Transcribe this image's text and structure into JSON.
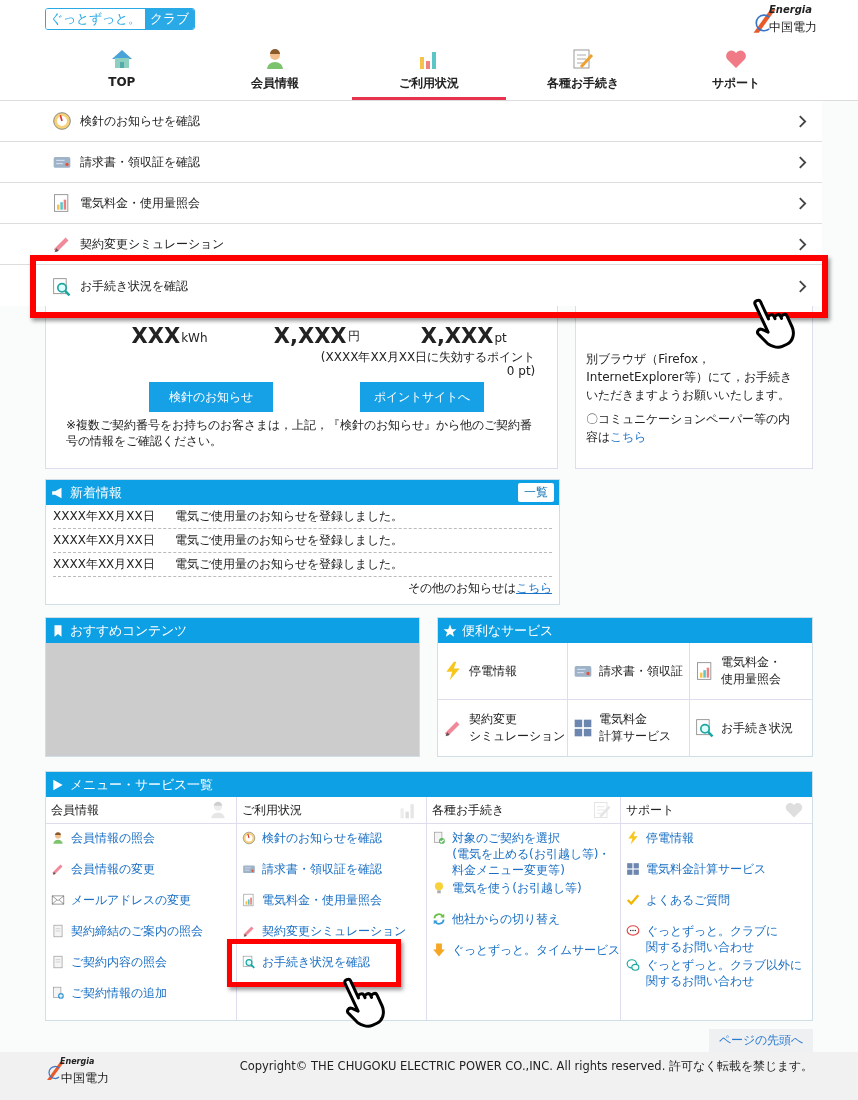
{
  "header": {
    "club_logo": {
      "text_1": "ぐっとずっと。",
      "text_2": "クラブ"
    },
    "brand": {
      "name": "Energia",
      "sub": "中国電力"
    }
  },
  "nav": [
    {
      "label": "TOP",
      "kind": "house",
      "selected": false
    },
    {
      "label": "会員情報",
      "kind": "person",
      "selected": false
    },
    {
      "label": "ご利用状況",
      "kind": "bars",
      "selected": true
    },
    {
      "label": "各種お手続き",
      "kind": "notepad",
      "selected": false
    },
    {
      "label": "サポート",
      "kind": "heart",
      "selected": false
    }
  ],
  "dropdown": [
    {
      "label": "検針のお知らせを確認",
      "kind": "gauge",
      "highlighted": false
    },
    {
      "label": "請求書・領収証を確認",
      "kind": "card",
      "highlighted": false
    },
    {
      "label": "電気料金・使用量照会",
      "kind": "sheet",
      "highlighted": false
    },
    {
      "label": "契約変更シミュレーション",
      "kind": "pencil",
      "highlighted": false
    },
    {
      "label": "お手続き状況を確認",
      "kind": "magnifier",
      "highlighted": true
    }
  ],
  "usage_card": {
    "values": [
      {
        "value": "XXX",
        "unit": "kWh"
      },
      {
        "value": "X,XXX",
        "unit": "円"
      },
      {
        "value": "X,XXX",
        "unit": "pt"
      }
    ],
    "expiry_note": "(XXXX年XX月XX日に失効するポイント",
    "expiry_points": "0 pt)",
    "buttons": [
      "検針のお知らせ",
      "ポイントサイトへ"
    ],
    "note": "※複数ご契約番号をお持ちのお客さまは，上記，『検針のお知らせ』から他のご契約番号の情報をご確認ください。"
  },
  "notice_card": {
    "text": "別ブラウザ（Firefox，InternetExplorer等）にて，お手続きいただきますようお願いいたします。",
    "link_prefix": "〇コミュニケーションペーパー等の内容は",
    "link": "こちら"
  },
  "news": {
    "title": "新着情報",
    "list_button": "一覧",
    "rows": [
      {
        "date": "XXXX年XX月XX日",
        "text": "電気ご使用量のお知らせを登録しました。"
      },
      {
        "date": "XXXX年XX月XX日",
        "text": "電気ご使用量のお知らせを登録しました。"
      },
      {
        "date": "XXXX年XX月XX日",
        "text": "電気ご使用量のお知らせを登録しました。"
      }
    ],
    "more_prefix": "その他のお知らせは",
    "more_link": "こちら"
  },
  "recommended": {
    "title": "おすすめコンテンツ"
  },
  "services": {
    "title": "便利なサービス",
    "items": [
      {
        "lines": [
          "停電情報"
        ],
        "kind": "bolt"
      },
      {
        "lines": [
          "請求書・領収証"
        ],
        "kind": "card"
      },
      {
        "lines": [
          "電気料金・",
          "使用量照会"
        ],
        "kind": "sheet"
      },
      {
        "lines": [
          "契約変更",
          "シミュレーション"
        ],
        "kind": "pencil"
      },
      {
        "lines": [
          "電気料金",
          "計算サービス"
        ],
        "kind": "calc"
      },
      {
        "lines": [
          "お手続き状況"
        ],
        "kind": "magnifier"
      }
    ]
  },
  "menu": {
    "title": "メニュー・サービス一覧",
    "columns": [
      {
        "heading": "会員情報",
        "kind": "person",
        "links": [
          {
            "lines": [
              "会員情報の照会"
            ],
            "kind": "person",
            "highlighted": false
          },
          {
            "lines": [
              "会員情報の変更"
            ],
            "kind": "pencil",
            "highlighted": false
          },
          {
            "lines": [
              "メールアドレスの変更"
            ],
            "kind": "envelope",
            "highlighted": false
          },
          {
            "lines": [
              "契約締結のご案内の照会"
            ],
            "kind": "document",
            "highlighted": false
          },
          {
            "lines": [
              "ご契約内容の照会"
            ],
            "kind": "document",
            "highlighted": false
          },
          {
            "lines": [
              "ご契約情報の追加"
            ],
            "kind": "docplus",
            "highlighted": false
          }
        ]
      },
      {
        "heading": "ご利用状況",
        "kind": "bars",
        "links": [
          {
            "lines": [
              "検針のお知らせを確認"
            ],
            "kind": "gauge",
            "highlighted": false
          },
          {
            "lines": [
              "請求書・領収証を確認"
            ],
            "kind": "card",
            "highlighted": false
          },
          {
            "lines": [
              "電気料金・使用量照会"
            ],
            "kind": "sheet",
            "highlighted": false
          },
          {
            "lines": [
              "契約変更シミュレーション"
            ],
            "kind": "pencil",
            "highlighted": false
          },
          {
            "lines": [
              "お手続き状況を確認"
            ],
            "kind": "magnifier",
            "highlighted": true
          }
        ]
      },
      {
        "heading": "各種お手続き",
        "kind": "notepad",
        "links": [
          {
            "lines": [
              "対象のご契約を選択",
              "(電気を止める(お引越し等)・",
              "料金メニュー変更等)"
            ],
            "kind": "doccheck",
            "highlighted": false
          },
          {
            "lines": [
              "電気を使う(お引越し等)"
            ],
            "kind": "bulb",
            "highlighted": false
          },
          {
            "lines": [
              "他社からの切り替え"
            ],
            "kind": "refresh",
            "highlighted": false
          },
          {
            "lines": [
              "ぐっとずっと。タイムサービス"
            ],
            "kind": "arrow",
            "highlighted": false
          }
        ]
      },
      {
        "heading": "サポート",
        "kind": "heart",
        "links": [
          {
            "lines": [
              "停電情報"
            ],
            "kind": "bolt",
            "highlighted": false
          },
          {
            "lines": [
              "電気料金計算サービス"
            ],
            "kind": "calc",
            "highlighted": false
          },
          {
            "lines": [
              "よくあるご質問"
            ],
            "kind": "check",
            "highlighted": false
          },
          {
            "lines": [
              "ぐっとずっと。クラブに",
              "関するお問い合わせ"
            ],
            "kind": "chat",
            "highlighted": false
          },
          {
            "lines": [
              "ぐっとずっと。クラブ以外に",
              "関するお問い合わせ"
            ],
            "kind": "question",
            "highlighted": false
          }
        ]
      }
    ]
  },
  "page_top": "ページの先頭へ",
  "footer": {
    "brand": {
      "name": "Energia",
      "sub": "中国電力"
    },
    "copyright": "Copyright© THE CHUGOKU ELECTRIC POWER CO.,INC. All rights reserved. 許可なく転載を禁じます。"
  }
}
